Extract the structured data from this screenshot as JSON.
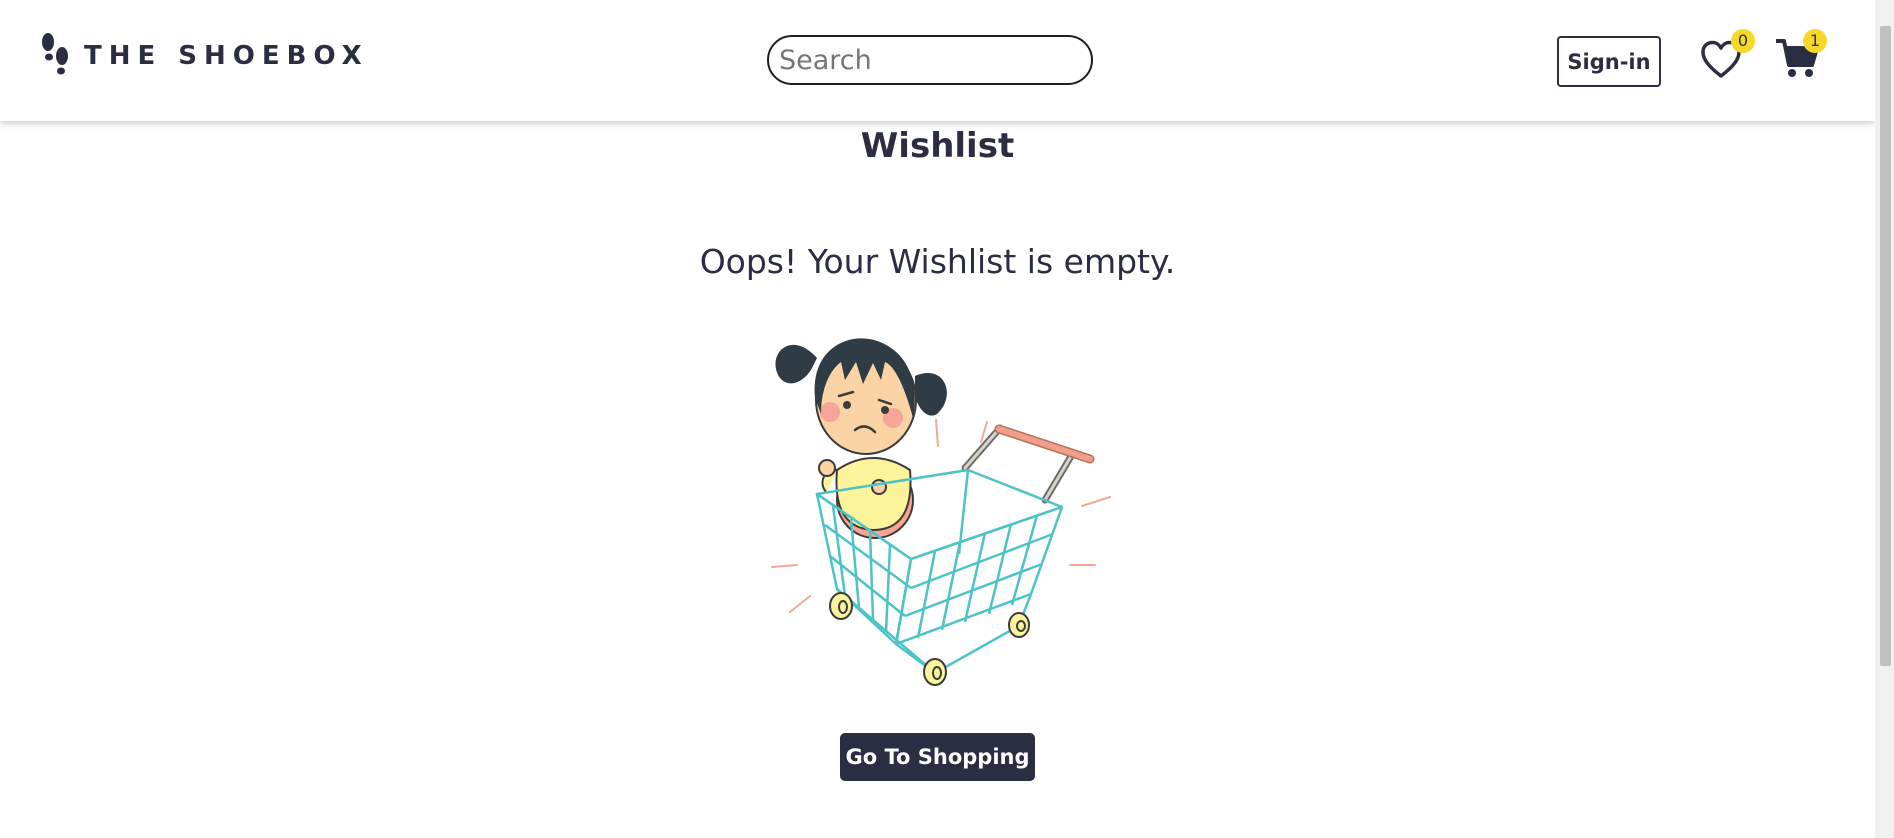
{
  "header": {
    "brand": "THE SHOEBOX",
    "search_placeholder": "Search",
    "signin_label": "Sign-in",
    "wishlist_count": "0",
    "cart_count": "1"
  },
  "main": {
    "title": "Wishlist",
    "empty_message": "Oops! Your Wishlist is empty.",
    "cta_label": "Go To Shopping"
  },
  "icons": {
    "logo": "footprints-icon",
    "wishlist": "heart-icon",
    "cart": "cart-icon"
  },
  "colors": {
    "primary": "#2b2d42",
    "badge": "#f7d82a",
    "illustration_cart": "#4cc3c6"
  }
}
